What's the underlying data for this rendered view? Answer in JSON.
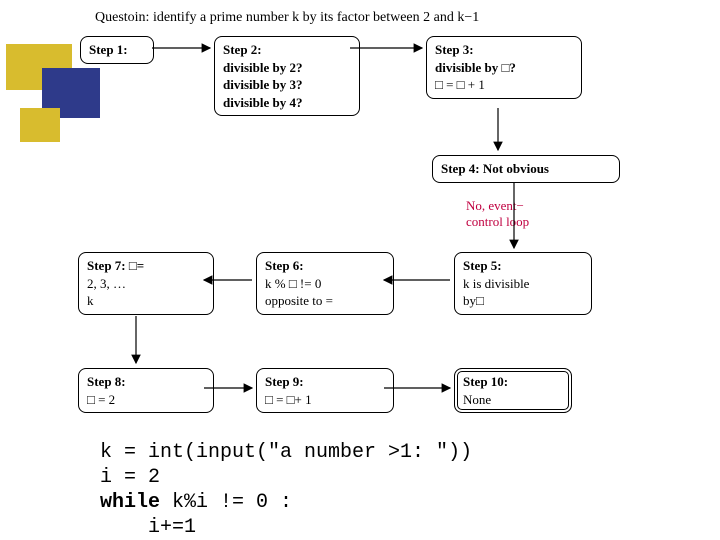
{
  "question": "Questoin: identify a prime number k by its factor between 2 and k−1",
  "steps": {
    "s1": {
      "title": "Step 1:"
    },
    "s2": {
      "title": "Step 2:",
      "l1": "divisible by 2?",
      "l2": "divisible by 3?",
      "l3": "divisible by 4?"
    },
    "s3": {
      "title": "Step 3:",
      "l1": "divisible by □?",
      "l2": "□  =  □ + 1"
    },
    "s4": {
      "title": "Step 4: Not obvious"
    },
    "s5": {
      "title": "Step 5:",
      "l1": "k is divisible",
      "l2": "by□"
    },
    "s6": {
      "title": "Step 6:",
      "l1": "k % □ != 0",
      "l2": "opposite to ="
    },
    "s7": {
      "title": "Step 7: □=",
      "l1": "2, 3, …",
      "l2": "k"
    },
    "s8": {
      "title": "Step 8:",
      "l1": "□  = 2"
    },
    "s9": {
      "title": "Step 9:",
      "l1": "□  = □+ 1"
    },
    "s10": {
      "title": "Step 10:",
      "l1": "None"
    }
  },
  "note": {
    "l1": "No, event−",
    "l2": "control loop"
  },
  "code": {
    "l1a": "k = int(input(",
    "l1b": "\"a number >1: \"",
    "l1c": "))",
    "l2": "i = 2",
    "l3a": "while",
    "l3b": " k%i != 0 :",
    "l4": "    i+=1"
  }
}
